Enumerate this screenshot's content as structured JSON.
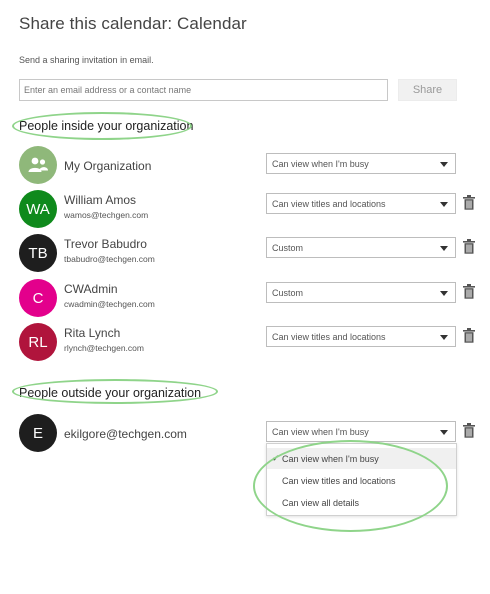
{
  "dialog": {
    "title": "Share this calendar: Calendar",
    "subtitle": "Send a sharing invitation in email.",
    "email_placeholder": "Enter an email address or a contact name",
    "share_label": "Share"
  },
  "inside": {
    "heading": "People inside your organization",
    "people": [
      {
        "initials": "",
        "name": "My Organization",
        "email": "",
        "permission": "Can view when I'm busy",
        "color": "#8fb87a",
        "icon": "people-group-icon"
      },
      {
        "initials": "WA",
        "name": "William Amos",
        "email": "wamos@techgen.com",
        "permission": "Can view titles and locations",
        "color": "#0f8a1c"
      },
      {
        "initials": "TB",
        "name": "Trevor Babudro",
        "email": "tbabudro@techgen.com",
        "permission": "Custom",
        "color": "#1e1e1e"
      },
      {
        "initials": "C",
        "name": "CWAdmin",
        "email": "cwadmin@techgen.com",
        "permission": "Custom",
        "color": "#e3008c"
      },
      {
        "initials": "RL",
        "name": "Rita Lynch",
        "email": "rlynch@techgen.com",
        "permission": "Can view titles and locations",
        "color": "#b0143c"
      }
    ]
  },
  "outside": {
    "heading": "People outside your organization",
    "people": [
      {
        "initials": "E",
        "name": "ekilgore@techgen.com",
        "email": "",
        "permission": "Can view when I'm busy",
        "color": "#1e1e1e"
      }
    ]
  },
  "dropdown": {
    "options": [
      "Can view when I'm busy",
      "Can view titles and locations",
      "Can view all details"
    ],
    "selected_index": 0
  },
  "colors": {
    "highlight_oval": "#8fd48a"
  }
}
